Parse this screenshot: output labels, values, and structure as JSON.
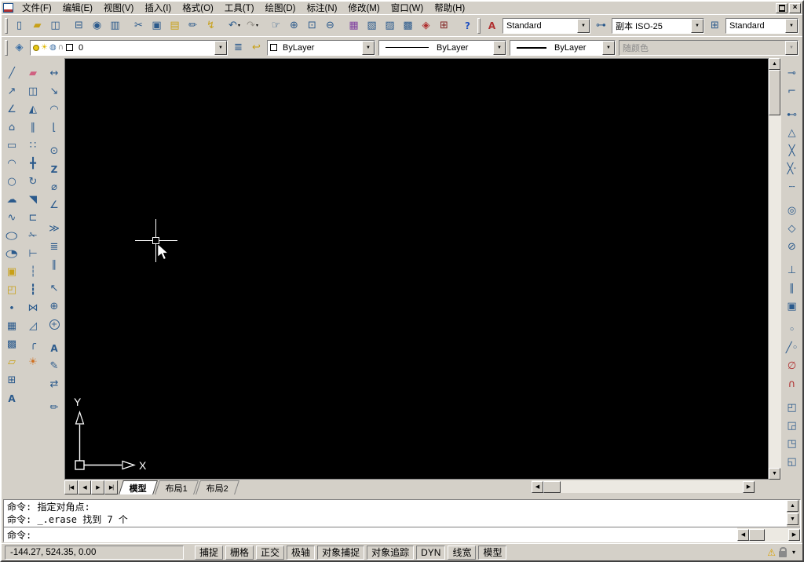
{
  "colors": {
    "face": "#d4d0c8",
    "hl": "#ffffff",
    "sh": "#808080",
    "dk": "#404040",
    "canvas": "#000000",
    "icon": "#2b5a8c",
    "icon_yellow": "#c8a018",
    "dis": "#8a8a8a"
  },
  "window": {
    "close_glyph": "×"
  },
  "menu_bar": {
    "items": [
      {
        "name": "menu-file",
        "label": "文件(F)"
      },
      {
        "name": "menu-edit",
        "label": "编辑(E)"
      },
      {
        "name": "menu-view",
        "label": "视图(V)"
      },
      {
        "name": "menu-insert",
        "label": "插入(I)"
      },
      {
        "name": "menu-format",
        "label": "格式(O)"
      },
      {
        "name": "menu-tools",
        "label": "工具(T)"
      },
      {
        "name": "menu-draw",
        "label": "绘图(D)"
      },
      {
        "name": "menu-dimension",
        "label": "标注(N)"
      },
      {
        "name": "menu-modify",
        "label": "修改(M)"
      },
      {
        "name": "menu-window",
        "label": "窗口(W)"
      },
      {
        "name": "menu-help",
        "label": "帮助(H)"
      }
    ]
  },
  "standard_toolbar": {
    "buttons": [
      {
        "name": "new-file-button",
        "glyph": "▯"
      },
      {
        "name": "open-button",
        "glyph": "▰",
        "color": "#c8a018"
      },
      {
        "name": "save-button",
        "glyph": "◫"
      },
      {
        "name": "plot-button",
        "glyph": "⊟",
        "classes": "group-start"
      },
      {
        "name": "plot-preview-button",
        "glyph": "◉"
      },
      {
        "name": "publish-button",
        "glyph": "▥"
      },
      {
        "name": "cut-button",
        "glyph": "✂",
        "classes": "group-start"
      },
      {
        "name": "copy-button",
        "glyph": "▣"
      },
      {
        "name": "paste-button",
        "glyph": "▤",
        "color": "#c8a018"
      },
      {
        "name": "match-properties-button",
        "glyph": "✏"
      },
      {
        "name": "block-editor-button",
        "glyph": "↯",
        "color": "#c8a018"
      },
      {
        "name": "undo-button",
        "glyph": "↶",
        "classes": "group-start has-flyout"
      },
      {
        "name": "redo-button",
        "glyph": "↷",
        "classes": "disabled has-flyout"
      },
      {
        "name": "pan-button",
        "glyph": "☞",
        "classes": "group-start"
      },
      {
        "name": "zoom-realtime-button",
        "glyph": "⊕"
      },
      {
        "name": "zoom-window-button",
        "glyph": "⊡"
      },
      {
        "name": "zoom-previous-button",
        "glyph": "⊖"
      },
      {
        "name": "properties-button",
        "glyph": "▦",
        "classes": "group-start",
        "color": "#8040a0"
      },
      {
        "name": "designcenter-button",
        "glyph": "▧"
      },
      {
        "name": "tool-palettes-button",
        "glyph": "▨"
      },
      {
        "name": "sheet-set-manager-button",
        "glyph": "▩"
      },
      {
        "name": "markup-set-manager-button",
        "glyph": "◈",
        "color": "#b03030"
      },
      {
        "name": "quickcalc-button",
        "glyph": "⊞",
        "color": "#802020"
      },
      {
        "name": "help-button",
        "glyph": "?",
        "classes": "group-start letter",
        "color": "#2050c0"
      }
    ]
  },
  "styles_toolbar": {
    "text_style_button": {
      "glyph": "A"
    },
    "text_style_value": "Standard",
    "dim_style_button": {
      "glyph": "⊶"
    },
    "dim_style_value": "副本 ISO-25",
    "table_style_button": {
      "glyph": "⊞"
    },
    "table_style_value": "Standard"
  },
  "layers_toolbar": {
    "manager_button": {
      "glyph": "◈"
    },
    "layer_item_icons": [
      {
        "name": "sun-icon",
        "glyph": "☀",
        "color": "#e0b800"
      },
      {
        "name": "viewport-freeze-icon",
        "glyph": "◍",
        "color": "#3a6ea5"
      },
      {
        "name": "unlock-icon",
        "glyph": "∩",
        "color": "#909090"
      }
    ],
    "current_layer": "0",
    "tools": [
      {
        "name": "make-object-layer-current-button",
        "glyph": "≣"
      },
      {
        "name": "layer-previous-button",
        "glyph": "↩",
        "color": "#c8a018"
      }
    ],
    "color_value": "ByLayer",
    "linetype_value": "ByLayer",
    "lineweight_value": "ByLayer",
    "plot_style_value": "随颜色"
  },
  "draw_toolbar": {
    "buttons": [
      {
        "name": "line-button",
        "glyph": "╱"
      },
      {
        "name": "construction-line-button",
        "glyph": "↗"
      },
      {
        "name": "polyline-button",
        "glyph": "∠"
      },
      {
        "name": "polygon-button",
        "glyph": "⌂"
      },
      {
        "name": "rectangle-button",
        "glyph": "▭"
      },
      {
        "name": "arc-button",
        "glyph": "◠"
      },
      {
        "name": "circle-button",
        "glyph": "○"
      },
      {
        "name": "revision-cloud-button",
        "glyph": "☁"
      },
      {
        "name": "spline-button",
        "glyph": "∿"
      },
      {
        "name": "ellipse-button",
        "glyph": "○",
        "classes": "wide"
      },
      {
        "name": "ellipse-arc-button",
        "glyph": "◔",
        "classes": "wide"
      },
      {
        "name": "insert-block-button",
        "glyph": "▣",
        "color": "#c8a018"
      },
      {
        "name": "make-block-button",
        "glyph": "◰",
        "color": "#c8a018"
      },
      {
        "name": "point-button",
        "glyph": "∙"
      },
      {
        "name": "hatch-button",
        "glyph": "▦"
      },
      {
        "name": "gradient-button",
        "glyph": "▩"
      },
      {
        "name": "region-button",
        "glyph": "▱",
        "color": "#c8a018"
      },
      {
        "name": "table-button",
        "glyph": "⊞"
      },
      {
        "name": "multiline-text-button",
        "glyph": "A",
        "classes": "letter"
      }
    ]
  },
  "modify_toolbar": {
    "buttons": [
      {
        "name": "erase-button",
        "glyph": "▰",
        "color": "#d06080"
      },
      {
        "name": "copy-object-button",
        "glyph": "◫"
      },
      {
        "name": "mirror-button",
        "glyph": "◭"
      },
      {
        "name": "offset-button",
        "glyph": "∥"
      },
      {
        "name": "array-button",
        "glyph": "∷"
      },
      {
        "name": "move-button",
        "glyph": "╋"
      },
      {
        "name": "rotate-button",
        "glyph": "↻"
      },
      {
        "name": "scale-button",
        "glyph": "◥"
      },
      {
        "name": "stretch-button",
        "glyph": "⊏"
      },
      {
        "name": "trim-button",
        "glyph": "✁"
      },
      {
        "name": "extend-button",
        "glyph": "⊢"
      },
      {
        "name": "break-at-point-button",
        "glyph": "┆"
      },
      {
        "name": "break-button",
        "glyph": "┇"
      },
      {
        "name": "join-button",
        "glyph": "⋈"
      },
      {
        "name": "chamfer-button",
        "glyph": "◿"
      },
      {
        "name": "fillet-button",
        "glyph": "╭"
      },
      {
        "name": "explode-button",
        "glyph": "☀",
        "color": "#d07020"
      }
    ]
  },
  "dimension_toolbar": {
    "buttons": [
      {
        "name": "linear-dimension-button",
        "glyph": "↔"
      },
      {
        "name": "aligned-dimension-button",
        "glyph": "↘"
      },
      {
        "name": "arc-length-dimension-button",
        "glyph": "◠"
      },
      {
        "name": "ordinate-dimension-button",
        "glyph": "⌊"
      },
      {
        "name": "radius-dimension-button",
        "glyph": "⊙",
        "classes": "group-start"
      },
      {
        "name": "jogged-dimension-button",
        "glyph": "Z",
        "classes": "letter"
      },
      {
        "name": "diameter-dimension-button",
        "glyph": "⌀"
      },
      {
        "name": "angular-dimension-button",
        "glyph": "∠"
      },
      {
        "name": "quick-dimension-button",
        "glyph": "≫",
        "classes": "group-start"
      },
      {
        "name": "baseline-dimension-button",
        "glyph": "≣"
      },
      {
        "name": "continue-dimension-button",
        "glyph": "∥"
      },
      {
        "name": "quick-leader-button",
        "glyph": "↖",
        "classes": "group-start"
      },
      {
        "name": "tolerance-button",
        "glyph": "⊕"
      },
      {
        "name": "center-mark-button",
        "glyph": "+",
        "classes": "circled"
      },
      {
        "name": "dimension-edit-button",
        "glyph": "A",
        "classes": "letter group-start"
      },
      {
        "name": "dimension-text-edit-button",
        "glyph": "✎"
      },
      {
        "name": "dimension-update-button",
        "glyph": "⇄"
      },
      {
        "name": "dimension-style-button",
        "glyph": "✏",
        "classes": "group-start"
      }
    ]
  },
  "osnap_toolbar": {
    "buttons": [
      {
        "name": "temporary-track-point-button",
        "glyph": "⊸"
      },
      {
        "name": "snap-from-button",
        "glyph": "⌐"
      },
      {
        "name": "snap-endpoint-button",
        "glyph": "⊷",
        "classes": "group-start"
      },
      {
        "name": "snap-midpoint-button",
        "glyph": "△"
      },
      {
        "name": "snap-intersection-button",
        "glyph": "╳"
      },
      {
        "name": "snap-apparent-intersection-button",
        "glyph": "╳·"
      },
      {
        "name": "snap-extension-button",
        "glyph": "┄"
      },
      {
        "name": "snap-center-button",
        "glyph": "◎",
        "classes": "group-start"
      },
      {
        "name": "snap-quadrant-button",
        "glyph": "◇"
      },
      {
        "name": "snap-tangent-button",
        "glyph": "⊘"
      },
      {
        "name": "snap-perpendicular-button",
        "glyph": "⊥",
        "classes": "group-start"
      },
      {
        "name": "snap-parallel-button",
        "glyph": "∥"
      },
      {
        "name": "snap-insert-button",
        "glyph": "▣"
      },
      {
        "name": "snap-node-button",
        "glyph": "◦",
        "classes": "group-start"
      },
      {
        "name": "snap-nearest-button",
        "glyph": "╱◦"
      },
      {
        "name": "snap-none-button",
        "glyph": "∅",
        "color": "#b03030"
      },
      {
        "name": "osnap-settings-button",
        "glyph": "∩",
        "color": "#b03030"
      }
    ]
  },
  "draworder_toolbar": {
    "buttons": [
      {
        "name": "bring-to-front-button",
        "glyph": "◰",
        "classes": "group-start"
      },
      {
        "name": "send-to-back-button",
        "glyph": "◲"
      },
      {
        "name": "bring-above-objects-button",
        "glyph": "◳"
      },
      {
        "name": "send-under-objects-button",
        "glyph": "◱"
      }
    ]
  },
  "drawing_area": {
    "ucs": {
      "x_label": "X",
      "y_label": "Y"
    }
  },
  "layout_tabs": {
    "nav": [
      {
        "name": "first-tab-button",
        "glyph": "|◀"
      },
      {
        "name": "previous-tab-button",
        "glyph": "◀"
      },
      {
        "name": "next-tab-button",
        "glyph": "▶"
      },
      {
        "name": "last-tab-button",
        "glyph": "▶|"
      }
    ],
    "tabs": [
      {
        "name": "tab-model",
        "label": "模型",
        "classes": "active"
      },
      {
        "name": "tab-layout1",
        "label": "布局1"
      },
      {
        "name": "tab-layout2",
        "label": "布局2"
      }
    ]
  },
  "scrollbars": {
    "up": "▲",
    "down": "▼",
    "left": "◀",
    "right": "▶"
  },
  "command_window": {
    "history_lines": [
      "命令: 指定对角点:",
      "命令: _.erase 找到 7 个"
    ],
    "prompt": "命令:"
  },
  "status_bar": {
    "coordinates": "-144.27, 524.35, 0.00",
    "toggles": [
      {
        "name": "toggle-snap",
        "label": "捕捉"
      },
      {
        "name": "toggle-grid",
        "label": "栅格"
      },
      {
        "name": "toggle-ortho",
        "label": "正交"
      },
      {
        "name": "toggle-polar",
        "label": "极轴",
        "classes": "pressed"
      },
      {
        "name": "toggle-osnap",
        "label": "对象捕捉",
        "classes": "pressed"
      },
      {
        "name": "toggle-otrack",
        "label": "对象追踪",
        "classes": "pressed"
      },
      {
        "name": "toggle-dyn",
        "label": "DYN",
        "classes": "pressed"
      },
      {
        "name": "toggle-lineweight",
        "label": "线宽"
      },
      {
        "name": "toggle-model-space",
        "label": "模型",
        "classes": "pressed"
      }
    ],
    "tray": {
      "warning_glyph": "⚠",
      "arrow_glyph": "▾"
    }
  }
}
